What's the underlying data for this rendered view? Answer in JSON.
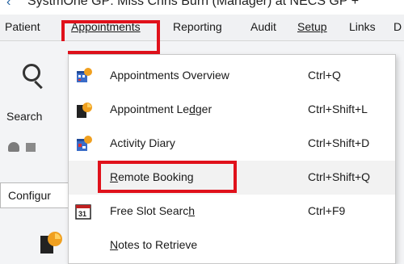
{
  "window": {
    "title": "SystmOne GP: Miss Chris Burn (Manager) at NECS GP +"
  },
  "menubar": {
    "items": [
      {
        "label": "Patient"
      },
      {
        "label": "Appointments"
      },
      {
        "label": "Reporting"
      },
      {
        "label": "Audit"
      },
      {
        "label": "Setup"
      },
      {
        "label": "Links"
      },
      {
        "label": "D"
      }
    ]
  },
  "toolbar": {
    "search_label": "Search",
    "configure_label": "Configur"
  },
  "appointments_menu": {
    "items": [
      {
        "label": "Appointments Overview",
        "shortcut": "Ctrl+Q",
        "icon": "appointments-overview-icon"
      },
      {
        "label": "Appointment Ledger",
        "shortcut": "Ctrl+Shift+L",
        "icon": "appointment-ledger-icon"
      },
      {
        "label": "Activity Diary",
        "shortcut": "Ctrl+Shift+D",
        "icon": "activity-diary-icon"
      },
      {
        "label": "Remote Booking",
        "shortcut": "Ctrl+Shift+Q",
        "icon": ""
      },
      {
        "label": "Free Slot Search",
        "shortcut": "Ctrl+F9",
        "icon": "calendar-31-icon"
      },
      {
        "label": "Notes to Retrieve",
        "shortcut": "",
        "icon": ""
      }
    ],
    "calendar_icon_text": "31"
  },
  "colors": {
    "highlight": "#e0111b",
    "menu_background": "#ffffff",
    "hover_row": "#f2f2f2"
  }
}
